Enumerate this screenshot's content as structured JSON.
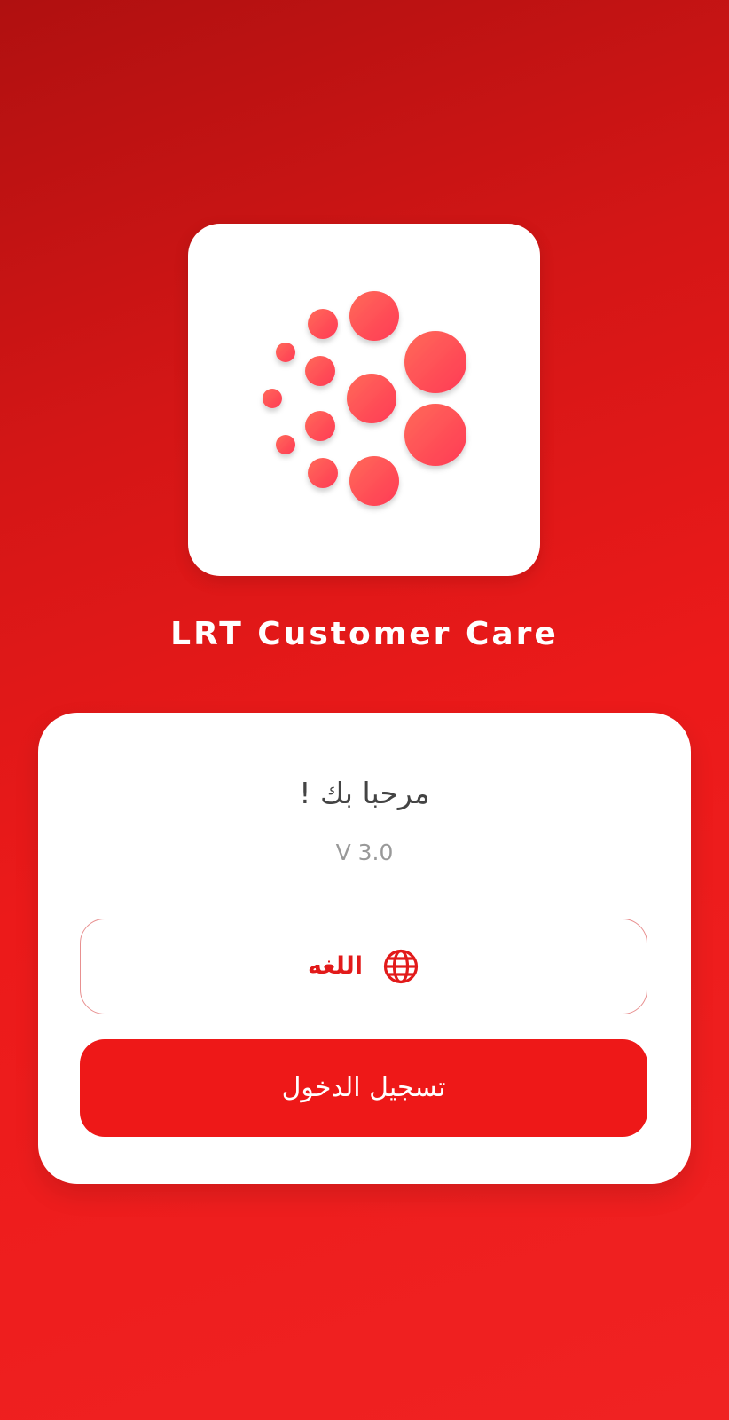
{
  "app": {
    "name": "LRT Customer Care",
    "logo_icon": "dots-burst-logo",
    "accent_color": "#ee1818"
  },
  "card": {
    "welcome": "مرحبا بك !",
    "version": "V 3.0",
    "language_button": {
      "label": "اللغه",
      "icon": "globe-icon"
    },
    "login_button": {
      "label": "تسجيل الدخول"
    }
  }
}
